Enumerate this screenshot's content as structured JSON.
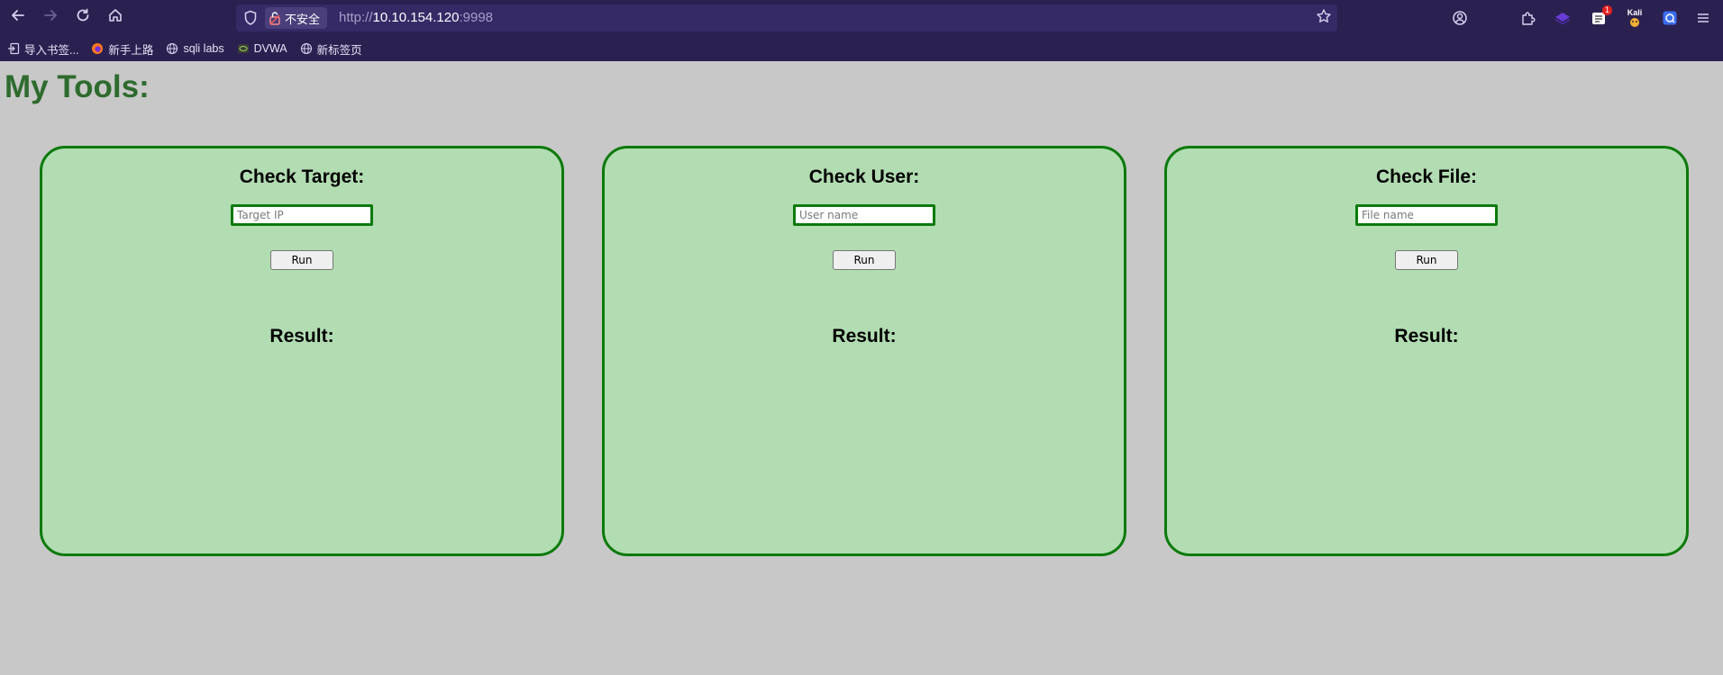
{
  "browser": {
    "url_scheme": "http://",
    "url_host": "10.10.154.120",
    "url_port": ":9998",
    "security_label": "不安全",
    "extension_badge": "1",
    "kali_label": "Kali"
  },
  "bookmarks": [
    {
      "label": "导入书签...",
      "icon": "import-icon"
    },
    {
      "label": "新手上路",
      "icon": "firefox-icon"
    },
    {
      "label": "sqli labs",
      "icon": "globe-icon"
    },
    {
      "label": "DVWA",
      "icon": "dvwa-icon"
    },
    {
      "label": "新标签页",
      "icon": "globe-icon"
    }
  ],
  "page": {
    "title": "My Tools:",
    "cards": [
      {
        "title": "Check Target:",
        "placeholder": "Target IP",
        "button": "Run",
        "result_label": "Result:"
      },
      {
        "title": "Check User:",
        "placeholder": "User name",
        "button": "Run",
        "result_label": "Result:"
      },
      {
        "title": "Check File:",
        "placeholder": "File name",
        "button": "Run",
        "result_label": "Result:"
      }
    ]
  },
  "colors": {
    "page_bg": "#c8c8c8",
    "card_bg": "#b2dcb2",
    "card_border": "#0b7a0b",
    "title_color": "#2e6b2e",
    "chrome_bg": "#2b2150"
  }
}
